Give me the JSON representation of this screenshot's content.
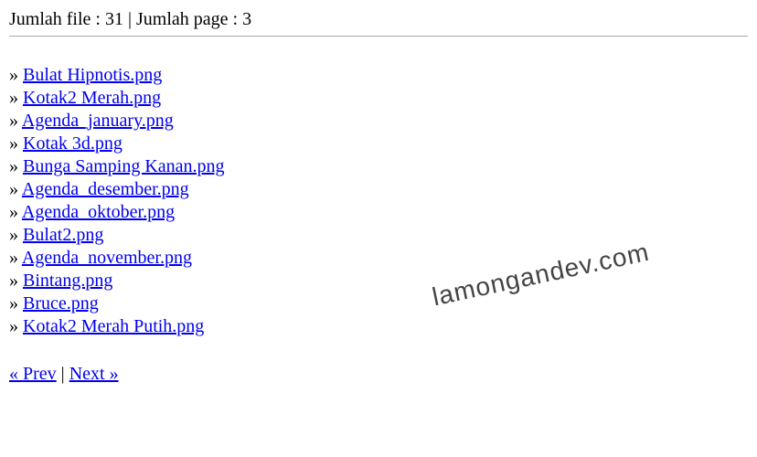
{
  "header": {
    "text": "Jumlah file : 31 | Jumlah page : 3"
  },
  "bullet": "» ",
  "files": [
    "Bulat Hipnotis.png",
    "Kotak2 Merah.png",
    "Agenda_january.png",
    "Kotak 3d.png",
    "Bunga Samping Kanan.png",
    "Agenda_desember.png",
    "Agenda_oktober.png",
    "Bulat2.png",
    "Agenda_november.png",
    "Bintang.png",
    "Bruce.png",
    "Kotak2 Merah Putih.png"
  ],
  "pagination": {
    "prev": "« Prev",
    "sep": " | ",
    "next": "Next »"
  },
  "watermark": "lamongandev.com"
}
